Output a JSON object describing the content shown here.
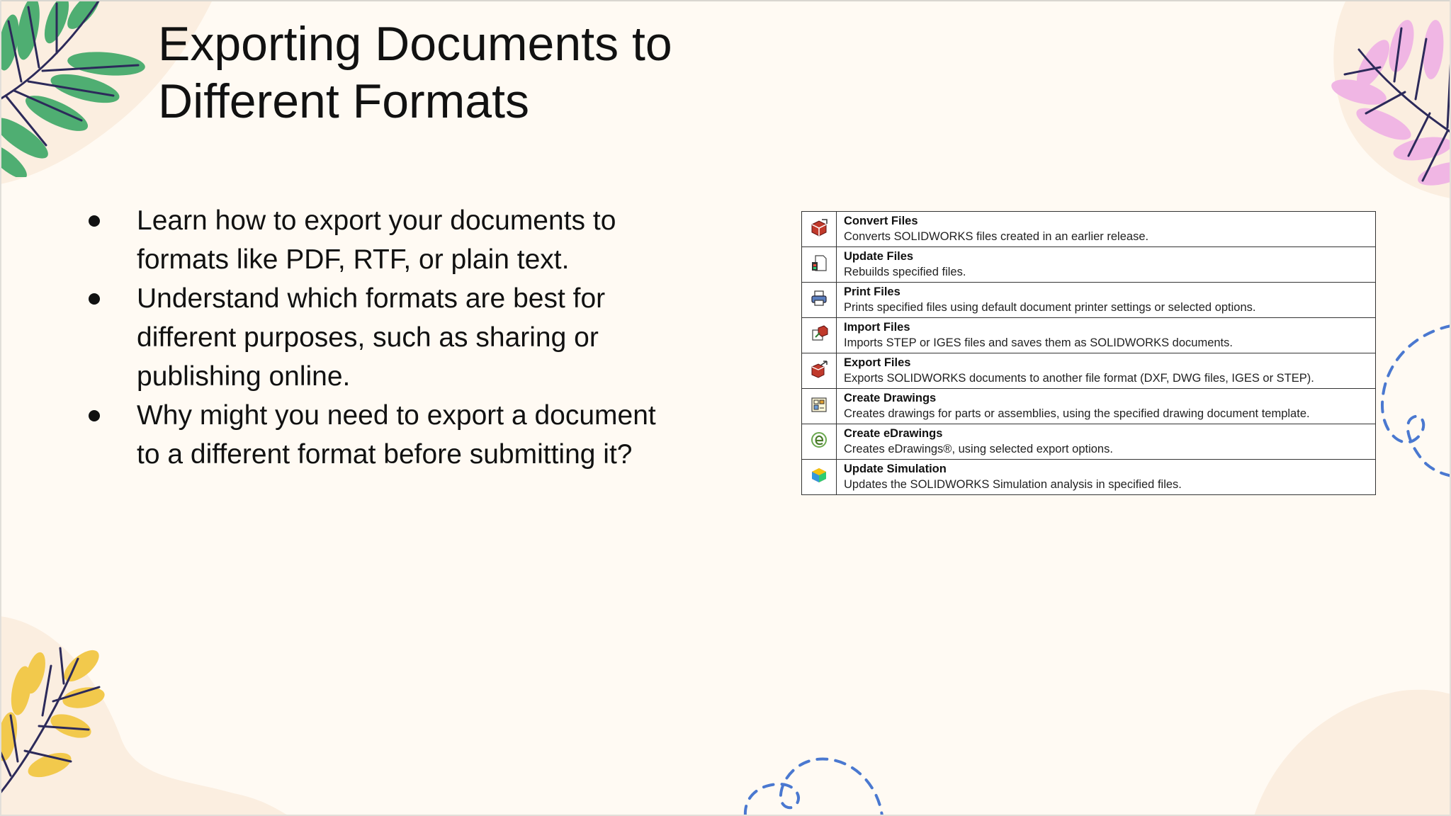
{
  "slide": {
    "title_line1": "Exporting Documents to",
    "title_line2": "Different Formats",
    "bullets": [
      {
        "line1": "Learn how to export your documents to",
        "line2": "formats like PDF, RTF, or plain text."
      },
      {
        "line1": "Understand which formats are best for",
        "line2": "different purposes, such as sharing or",
        "line3": "publishing online."
      },
      {
        "line1": "Why might you need to export a document",
        "line2": "to a different format before submitting it?"
      }
    ]
  },
  "commands": [
    {
      "name": "Convert Files",
      "desc": "Converts SOLIDWORKS  files created in an earlier release.",
      "icon": "convert-files-icon"
    },
    {
      "name": "Update Files",
      "desc": "Rebuilds specified files.",
      "icon": "update-files-icon"
    },
    {
      "name": "Print Files",
      "desc": "Prints specified files using default document printer settings or selected options.",
      "icon": "print-files-icon"
    },
    {
      "name": "Import Files",
      "desc": "Imports STEP or IGES files and saves them as SOLIDWORKS  documents.",
      "icon": "import-files-icon"
    },
    {
      "name": "Export Files",
      "desc": "Exports SOLIDWORKS  documents to another file format (DXF,  DWG files, IGES or STEP).",
      "icon": "export-files-icon"
    },
    {
      "name": "Create Drawings",
      "desc": "Creates drawings for parts or assemblies, using the specified drawing document template.",
      "icon": "create-drawings-icon"
    },
    {
      "name": "Create eDrawings",
      "desc": "Creates eDrawings®, using selected export options.",
      "icon": "create-edrawings-icon"
    },
    {
      "name": "Update Simulation",
      "desc": "Updates the SOLIDWORKS  Simulation analysis in specified files.",
      "icon": "update-simulation-icon"
    }
  ],
  "colors": {
    "background": "#fffaf3",
    "leaf_green": "#4fae72",
    "leaf_pink": "#f0b6e4",
    "leaf_yellow": "#f2c94c",
    "stem_navy": "#2c2a5a",
    "dash_blue": "#4a78d0",
    "blob_peach": "#fbeee0"
  }
}
